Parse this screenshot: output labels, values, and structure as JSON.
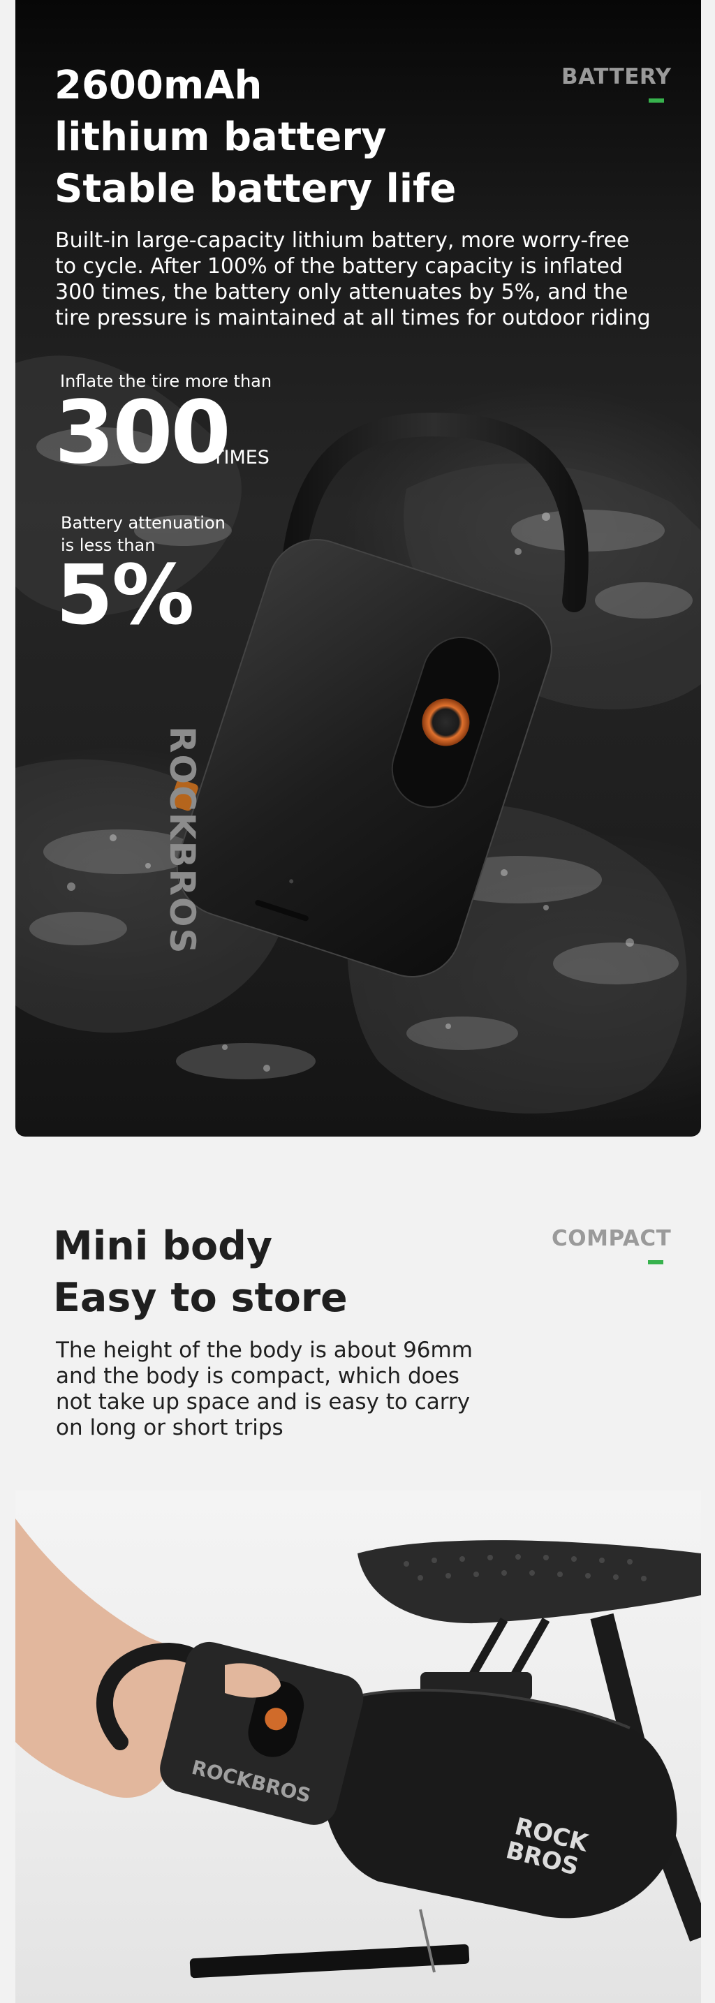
{
  "battery_section": {
    "tag": "BATTERY",
    "headline": [
      "2600mAh",
      "lithium battery",
      "Stable battery life"
    ],
    "description": [
      "Built-in large-capacity lithium battery, more worry-free",
      "to cycle. After 100% of the battery capacity is inflated",
      "300 times, the battery only attenuates by 5%, and the",
      "tire pressure is maintained at all times for outdoor riding"
    ],
    "stat_inflate": {
      "label": "Inflate the tire more than",
      "value": "300",
      "unit": "TIMES"
    },
    "stat_attenuation": {
      "label": [
        "Battery attenuation",
        "is less than"
      ],
      "value": "5%"
    },
    "product_brand": "ROCKBROS"
  },
  "compact_section": {
    "tag": "COMPACT",
    "headline": [
      "Mini body",
      "Easy to store"
    ],
    "description": [
      "The height of the body is about 96mm",
      "and the body is compact, which does",
      "not take up space and is easy to carry",
      "on long or short trips"
    ],
    "pump_brand": "ROCKBROS",
    "bag_brand": [
      "ROCK",
      "BROS"
    ]
  },
  "colors": {
    "accent_green": "#37b24d",
    "tag_gray": "#9a9a9a",
    "headline_dark": "#1f1f1f",
    "text_white": "#ffffff"
  }
}
